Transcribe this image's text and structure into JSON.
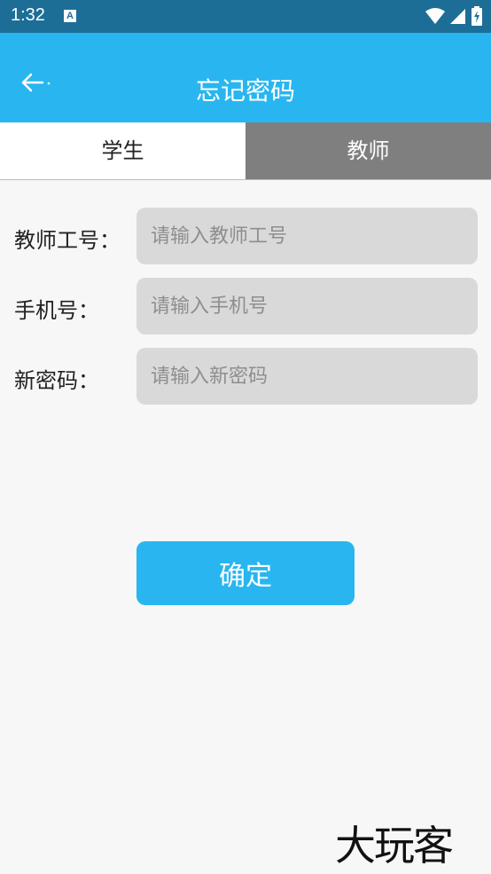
{
  "status_bar": {
    "time": "1:32",
    "notification_icon": "A"
  },
  "app_bar": {
    "title": "忘记密码",
    "back_icon": "arrow-left"
  },
  "tabs": [
    {
      "label": "学生",
      "selected": false
    },
    {
      "label": "教师",
      "selected": true
    }
  ],
  "form": {
    "teacher_id": {
      "label": "教师工号：",
      "placeholder": "请输入教师工号",
      "value": ""
    },
    "phone": {
      "label": "手机号：",
      "placeholder": "请输入手机号",
      "value": ""
    },
    "new_password": {
      "label": "新密码：",
      "placeholder": "请输入新密码",
      "value": ""
    }
  },
  "confirm_button": {
    "label": "确定"
  },
  "watermark": {
    "text": "大玩客"
  },
  "colors": {
    "primary": "#29b6f0",
    "status_bar": "#1d6e97",
    "tab_selected": "#7f7f7f",
    "input_bg": "#d9d9d9"
  }
}
